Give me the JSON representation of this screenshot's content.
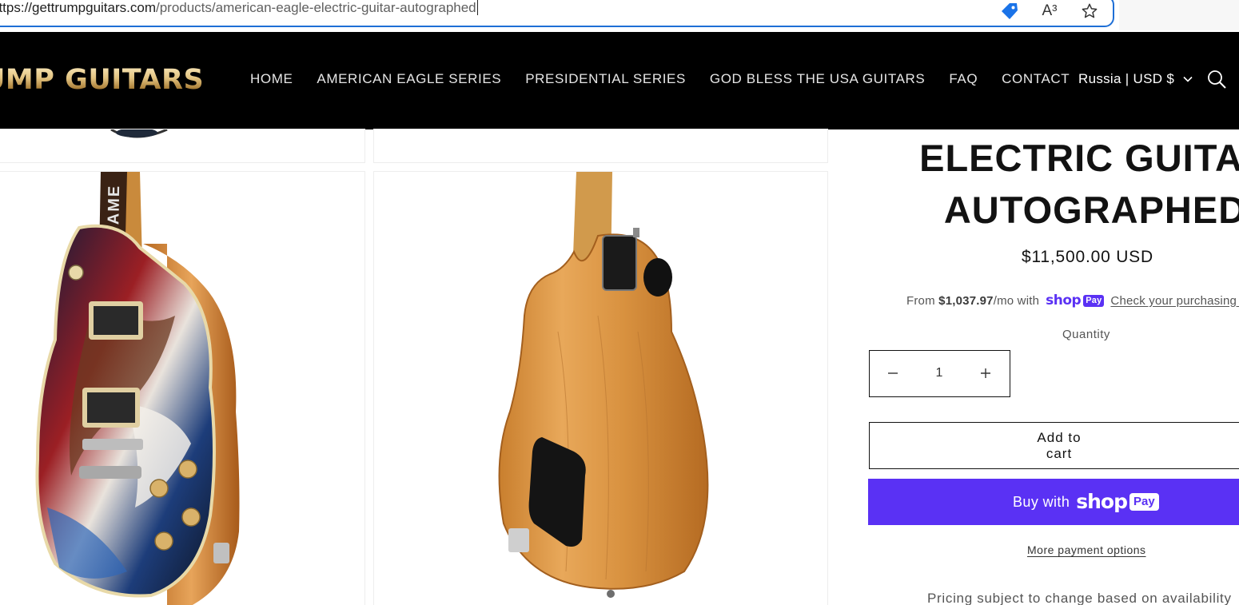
{
  "browser": {
    "url_host": "https://gettrumpguitars.com",
    "url_path": "/products/american-eagle-electric-guitar-autographed",
    "icons": [
      "tag-icon",
      "read-aloud-icon",
      "favorite-star-icon"
    ],
    "read_aloud_glyph": "A³"
  },
  "header": {
    "logo_text": "UMP GUITARS",
    "nav": [
      "HOME",
      "AMERICAN EAGLE SERIES",
      "PRESIDENTIAL SERIES",
      "GOD BLESS THE USA GUITARS",
      "FAQ",
      "CONTACT"
    ],
    "country": "Russia | USD $",
    "icons": [
      "chevron-down-icon",
      "search-icon"
    ]
  },
  "product": {
    "title_line1": "ELECTRIC GUITAR",
    "title_line2": "AUTOGRAPHED",
    "price": "$11,500.00 USD",
    "installments": {
      "prefix": "From ",
      "amount": "$1,037.97",
      "suffix": "/mo with",
      "shop_word": "shop",
      "pay_word": "Pay",
      "link": "Check your purchasing power"
    },
    "quantity_label": "Quantity",
    "quantity_value": "1",
    "add_to_cart": "Add to cart",
    "buy_with": "Buy with",
    "buy_shop_word": "shop",
    "buy_pay_word": "Pay",
    "more_payment": "More payment options",
    "pricing_note": "Pricing subject to change based on availability"
  },
  "gallery": {
    "images": [
      "guitar-front-angled",
      "guitar-back"
    ],
    "neck_inlay_text": "MAKE AMERICA"
  },
  "colors": {
    "accent_blue": "#1e6fd6",
    "shop_pay_purple": "#5a31f4",
    "header_bg": "#000000",
    "logo_gold": "#d8b46a"
  }
}
